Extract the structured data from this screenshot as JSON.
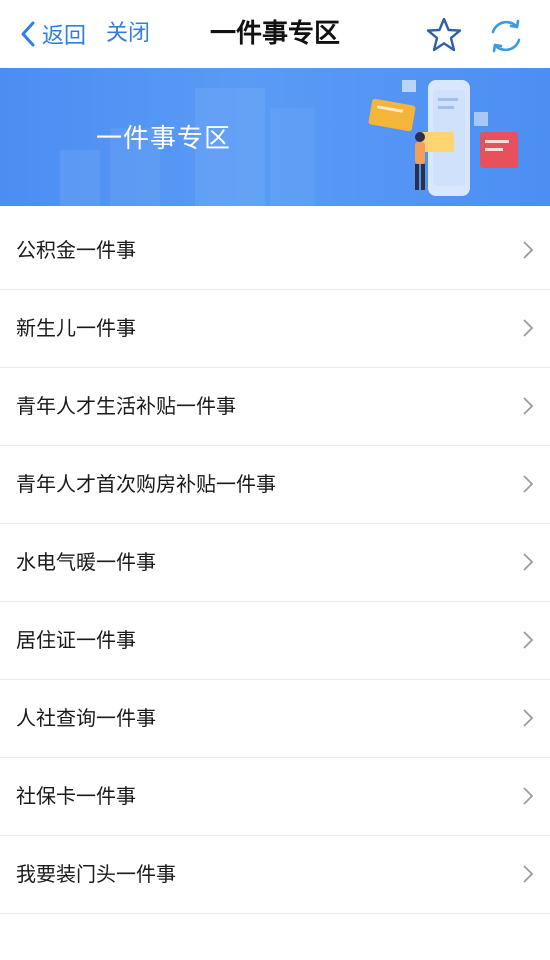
{
  "navbar": {
    "back_label": "返回",
    "close_label": "关闭",
    "title": "一件事专区",
    "icons": {
      "back": "chevron-left-icon",
      "favorite": "star-icon",
      "refresh": "refresh-icon"
    },
    "accent_color": "#2f7fe0"
  },
  "banner": {
    "title": "一件事专区",
    "background_color": "#4d8ef3"
  },
  "list": {
    "items": [
      {
        "label": "公积金一件事"
      },
      {
        "label": "新生儿一件事"
      },
      {
        "label": "青年人才生活补贴一件事"
      },
      {
        "label": "青年人才首次购房补贴一件事"
      },
      {
        "label": "水电气暖一件事"
      },
      {
        "label": "居住证一件事"
      },
      {
        "label": "人社查询一件事"
      },
      {
        "label": "社保卡一件事"
      },
      {
        "label": "我要装门头一件事"
      }
    ],
    "item_icon": "chevron-right-icon"
  }
}
